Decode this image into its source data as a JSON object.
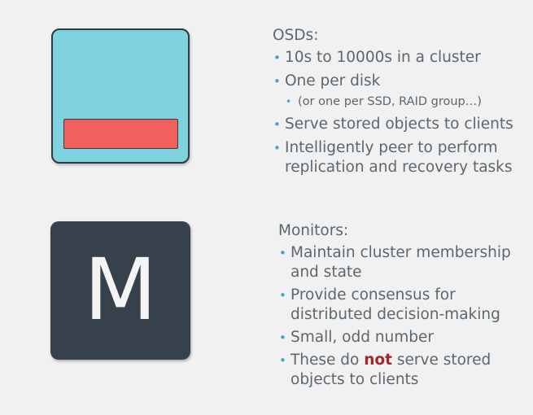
{
  "osd": {
    "heading": "OSDs:",
    "items": [
      "10s to 10000s in a cluster",
      "One per disk",
      "Serve stored objects to clients",
      "Intelligently peer to perform replication and recovery tasks"
    ],
    "sub_item": "(or one per SSD, RAID group…)"
  },
  "monitor": {
    "icon_letter": "M",
    "heading": "Monitors:",
    "items": [
      "Maintain cluster membership and state",
      "Provide consensus for distributed decision-making",
      "Small, odd number"
    ],
    "last_item": {
      "prefix": "These do ",
      "emphasis": "not",
      "suffix": " serve stored objects to clients"
    }
  },
  "colors": {
    "osd_body": "#7fd2df",
    "osd_disk": "#f0605c",
    "monitor_body": "#36414b",
    "bullet": "#3aa7c4",
    "emphasis": "#a3262b",
    "text": "#5b6770",
    "background": "#f1f1f1"
  },
  "icons": [
    "osd-icon",
    "monitor-icon"
  ]
}
